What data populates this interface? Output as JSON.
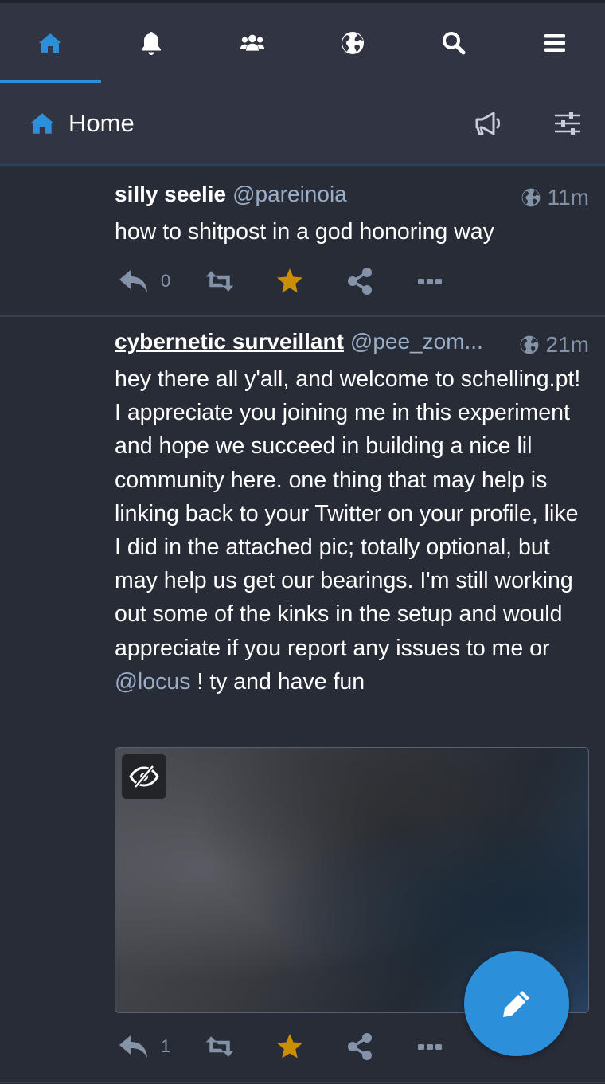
{
  "nav": {
    "tabs": [
      {
        "icon": "home-icon",
        "active": true
      },
      {
        "icon": "bell-icon",
        "active": false
      },
      {
        "icon": "users-icon",
        "active": false
      },
      {
        "icon": "globe-icon",
        "active": false
      },
      {
        "icon": "search-icon",
        "active": false
      },
      {
        "icon": "menu-icon",
        "active": false
      }
    ]
  },
  "header": {
    "title": "Home",
    "icons": [
      "home-icon",
      "announcements-icon",
      "settings-sliders-icon"
    ]
  },
  "colors": {
    "accent": "#2b90d9",
    "background": "#282c37",
    "panel": "#313543",
    "muted": "#8593a9",
    "star": "#ca8f04"
  },
  "statuses": [
    {
      "display_name": "silly seelie",
      "acct": "@pareinoia",
      "visibility_icon": "globe-icon",
      "time": "11m",
      "text": "how to shitpost in a god honoring way",
      "reply_count": "0",
      "favourited": true
    },
    {
      "display_name": "cybernetic surveillant",
      "acct": "@pee_zom...",
      "visibility_icon": "globe-icon",
      "time": "21m",
      "text_before_mention": "hey there all y'all, and welcome to schelling.pt! I appreciate you joining me in this experiment and hope we succeed in building a nice lil community here. one thing that may help is linking back to your Twitter on your profile, like I did in the attached pic; totally optional, but may help us get our bearings. I'm still working out some of the kinks in the setup and would appreciate if you report any issues to me or ",
      "mention": "@locus",
      "text_after_mention": " ! ty and have fun",
      "media": {
        "sensitive_hidden": true,
        "toggle_icon": "eye-slash-icon"
      },
      "reply_count": "1",
      "favourited": true
    }
  ],
  "fab": {
    "icon": "pencil-icon"
  }
}
